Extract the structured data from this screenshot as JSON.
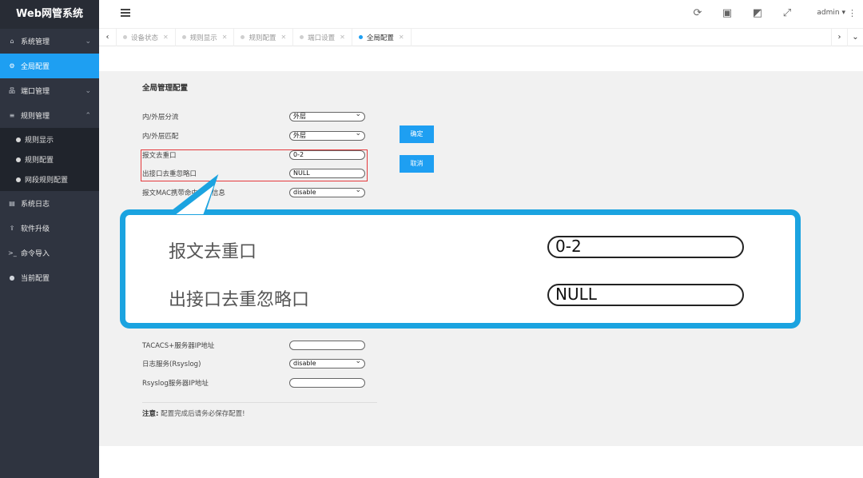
{
  "app_title": "Web网管系统",
  "sidebar": {
    "items": [
      {
        "label": "系统管理",
        "icon": "home-icon",
        "chevron": "down"
      },
      {
        "label": "全局配置",
        "icon": "gears-icon",
        "active": true
      },
      {
        "label": "端口管理",
        "icon": "sitemap-icon",
        "chevron": "down"
      },
      {
        "label": "规则管理",
        "icon": "sliders-icon",
        "chevron": "up"
      }
    ],
    "sub_items": [
      {
        "label": "规则显示"
      },
      {
        "label": "规则配置"
      },
      {
        "label": "网段规则配置"
      }
    ],
    "items_after": [
      {
        "label": "系统日志",
        "icon": "file-icon"
      },
      {
        "label": "软件升级",
        "icon": "upload-icon"
      },
      {
        "label": "命令导入",
        "icon": "terminal-icon"
      },
      {
        "label": "当前配置",
        "icon": "map-pin-icon"
      }
    ]
  },
  "header": {
    "user": "admin ▾"
  },
  "tabs": [
    {
      "label": "设备状态",
      "active": false
    },
    {
      "label": "规则显示",
      "active": false
    },
    {
      "label": "规则配置",
      "active": false
    },
    {
      "label": "端口设置",
      "active": false
    },
    {
      "label": "全局配置",
      "active": true
    }
  ],
  "panel": {
    "title": "全局管理配置",
    "rows": [
      {
        "label": "内/外层分流",
        "value": "外层",
        "type": "select"
      },
      {
        "label": "内/外层匹配",
        "value": "外层",
        "type": "select"
      },
      {
        "label": "报文去重口",
        "value": "0-2",
        "type": "input"
      },
      {
        "label": "出接口去重忽略口",
        "value": "NULL",
        "type": "input"
      },
      {
        "label": "报文MAC携带命中规则信息",
        "value": "disable",
        "type": "select"
      }
    ],
    "rows_lower": [
      {
        "label": "TACACS+服务器IP地址",
        "value": "",
        "type": "input"
      },
      {
        "label": "日志服务(Rsyslog)",
        "value": "disable",
        "type": "select"
      },
      {
        "label": "Rsyslog服务器IP地址",
        "value": "",
        "type": "input"
      }
    ],
    "confirm_label": "确定",
    "cancel_label": "取消",
    "note_bold": "注意:",
    "note_text": " 配置完成后请务必保存配置!"
  },
  "callout": {
    "row1_label": "报文去重口",
    "row1_value": "0-2",
    "row2_label": "出接口去重忽略口",
    "row2_value": "NULL"
  },
  "colors": {
    "accent": "#1e9ff2",
    "sidebar_bg": "#2f3440",
    "highlight_border": "#e4393c",
    "callout_border": "#1ba3e0"
  }
}
